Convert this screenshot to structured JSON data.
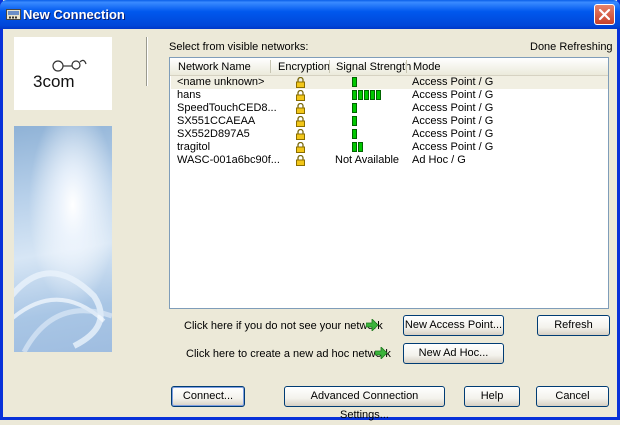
{
  "window": {
    "title": "New Connection"
  },
  "logo": {
    "brand": "3com"
  },
  "main": {
    "select_label": "Select from visible networks:",
    "status": "Done Refreshing"
  },
  "list": {
    "columns": [
      "Network Name",
      "Encryption",
      "Signal Strength",
      "Mode"
    ],
    "rows": [
      {
        "name": "<name unknown>",
        "encryption": "lock-icon",
        "signal": 1,
        "signal_text": "",
        "mode": "Access Point / G"
      },
      {
        "name": "hans",
        "encryption": "lock-icon",
        "signal": 5,
        "signal_text": "",
        "mode": "Access Point / G"
      },
      {
        "name": "SpeedTouchCED8...",
        "encryption": "lock-icon",
        "signal": 1,
        "signal_text": "",
        "mode": "Access Point / G"
      },
      {
        "name": "SX551CCAEAA",
        "encryption": "lock-icon",
        "signal": 1,
        "signal_text": "",
        "mode": "Access Point / G"
      },
      {
        "name": "SX552D897A5",
        "encryption": "lock-icon",
        "signal": 1,
        "signal_text": "",
        "mode": "Access Point / G"
      },
      {
        "name": "tragitol",
        "encryption": "lock-icon",
        "signal": 2,
        "signal_text": "",
        "mode": "Access Point / G"
      },
      {
        "name": "WASC-001a6bc90f...",
        "encryption": "lock-icon",
        "signal": 0,
        "signal_text": "Not Available",
        "mode": "Ad Hoc / G"
      }
    ]
  },
  "hints": {
    "not_see": "Click here if you do not see your network",
    "adhoc": "Click here to create a new ad hoc network"
  },
  "buttons": {
    "new_access_point": "New Access Point...",
    "refresh": "Refresh",
    "new_ad_hoc": "New Ad Hoc...",
    "connect": "Connect...",
    "advanced": "Advanced Connection Settings...",
    "help": "Help",
    "cancel": "Cancel"
  },
  "colors": {
    "title_bar": "#0058EE",
    "signal_bar": "#00C800",
    "arrow": "#3CB43C"
  }
}
